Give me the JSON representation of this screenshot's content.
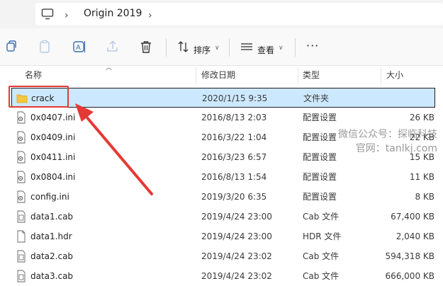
{
  "address": {
    "breadcrumb": "Origin 2019",
    "computer_icon": "computer-icon",
    "chevron": "›"
  },
  "toolbar": {
    "sort_label": "排序",
    "view_label": "查看",
    "more_label": "···"
  },
  "columns": {
    "name": "名称",
    "date": "修改日期",
    "type": "类型",
    "size": "大小"
  },
  "files": [
    {
      "name": "crack",
      "date": "2020/1/15 9:35",
      "type": "文件夹",
      "size": "",
      "icon": "folder-icon",
      "selected": true
    },
    {
      "name": "0x0407.ini",
      "date": "2016/8/13 2:03",
      "type": "配置设置",
      "size": "26 KB",
      "icon": "ini-file-icon"
    },
    {
      "name": "0x0409.ini",
      "date": "2016/3/22 1:04",
      "type": "配置设置",
      "size": "22 KB",
      "icon": "ini-file-icon"
    },
    {
      "name": "0x0411.ini",
      "date": "2016/3/23 6:57",
      "type": "配置设置",
      "size": "15 KB",
      "icon": "ini-file-icon"
    },
    {
      "name": "0x0804.ini",
      "date": "2016/8/13 1:54",
      "type": "配置设置",
      "size": "11 KB",
      "icon": "ini-file-icon"
    },
    {
      "name": "config.ini",
      "date": "2019/3/20 6:35",
      "type": "配置设置",
      "size": "8 KB",
      "icon": "ini-file-icon"
    },
    {
      "name": "data1.cab",
      "date": "2019/4/24 23:00",
      "type": "Cab 文件",
      "size": "67,400 KB",
      "icon": "cab-file-icon"
    },
    {
      "name": "data1.hdr",
      "date": "2019/4/24 23:00",
      "type": "HDR 文件",
      "size": "2,040 KB",
      "icon": "file-icon"
    },
    {
      "name": "data2.cab",
      "date": "2019/4/24 23:02",
      "type": "Cab 文件",
      "size": "594,318 KB",
      "icon": "cab-file-icon"
    },
    {
      "name": "data3.cab",
      "date": "2019/4/24 23:02",
      "type": "Cab 文件",
      "size": "666,000 KB",
      "icon": "cab-file-icon"
    }
  ],
  "watermark": {
    "line1": "微信公众号：探临科技",
    "line2": "官网：tanlkj.com"
  },
  "colors": {
    "selection": "#cce8ff",
    "highlight_box": "#e53935",
    "folder": "#f5c542"
  }
}
